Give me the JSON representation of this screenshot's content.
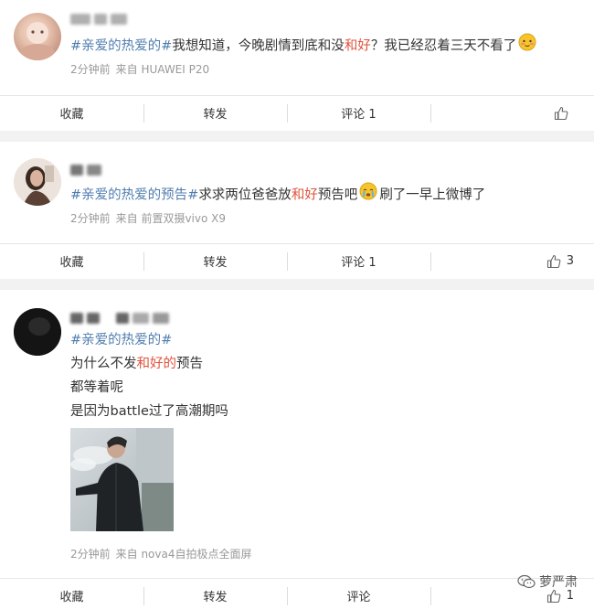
{
  "posts": [
    {
      "hashtag": "#亲爱的热爱的#",
      "segments": [
        "我想知道，今晚剧情到底和没",
        "和好",
        "？我已经忍着三天不看了"
      ],
      "time": "2分钟前",
      "source": "来自 HUAWEI P20",
      "actions": {
        "fav": "收藏",
        "repost": "转发",
        "comment": "评论 1",
        "like_count": ""
      }
    },
    {
      "hashtag_a": "#亲爱的热爱的",
      "hashtag_b": "预告#",
      "segments": [
        "求求两位爸爸放",
        "和好",
        "预告吧",
        "刷了一早上微博了"
      ],
      "time": "2分钟前",
      "source": "来自 前置双摄vivo X9",
      "actions": {
        "fav": "收藏",
        "repost": "转发",
        "comment": "评论 1",
        "like_count": "3"
      }
    },
    {
      "hashtag": "#亲爱的热爱的#",
      "line2": [
        "为什么不发",
        "和好的",
        "预告"
      ],
      "line3": "都等着呢",
      "line4": "是因为battle过了高潮期吗",
      "time": "2分钟前",
      "source": "来自 nova4自拍极点全面屏",
      "actions": {
        "fav": "收藏",
        "repost": "转发",
        "comment": "评论",
        "like_count": "1"
      }
    }
  ],
  "watermark": "萝严肃",
  "colors": {
    "hashtag": "#507daf",
    "highlight": "#e0533b",
    "meta": "#999999",
    "bg": "#f2f2f2"
  },
  "icons": [
    "thumbs-up-icon",
    "blushing-emoji-icon",
    "crying-emoji-icon",
    "wechat-icon"
  ]
}
